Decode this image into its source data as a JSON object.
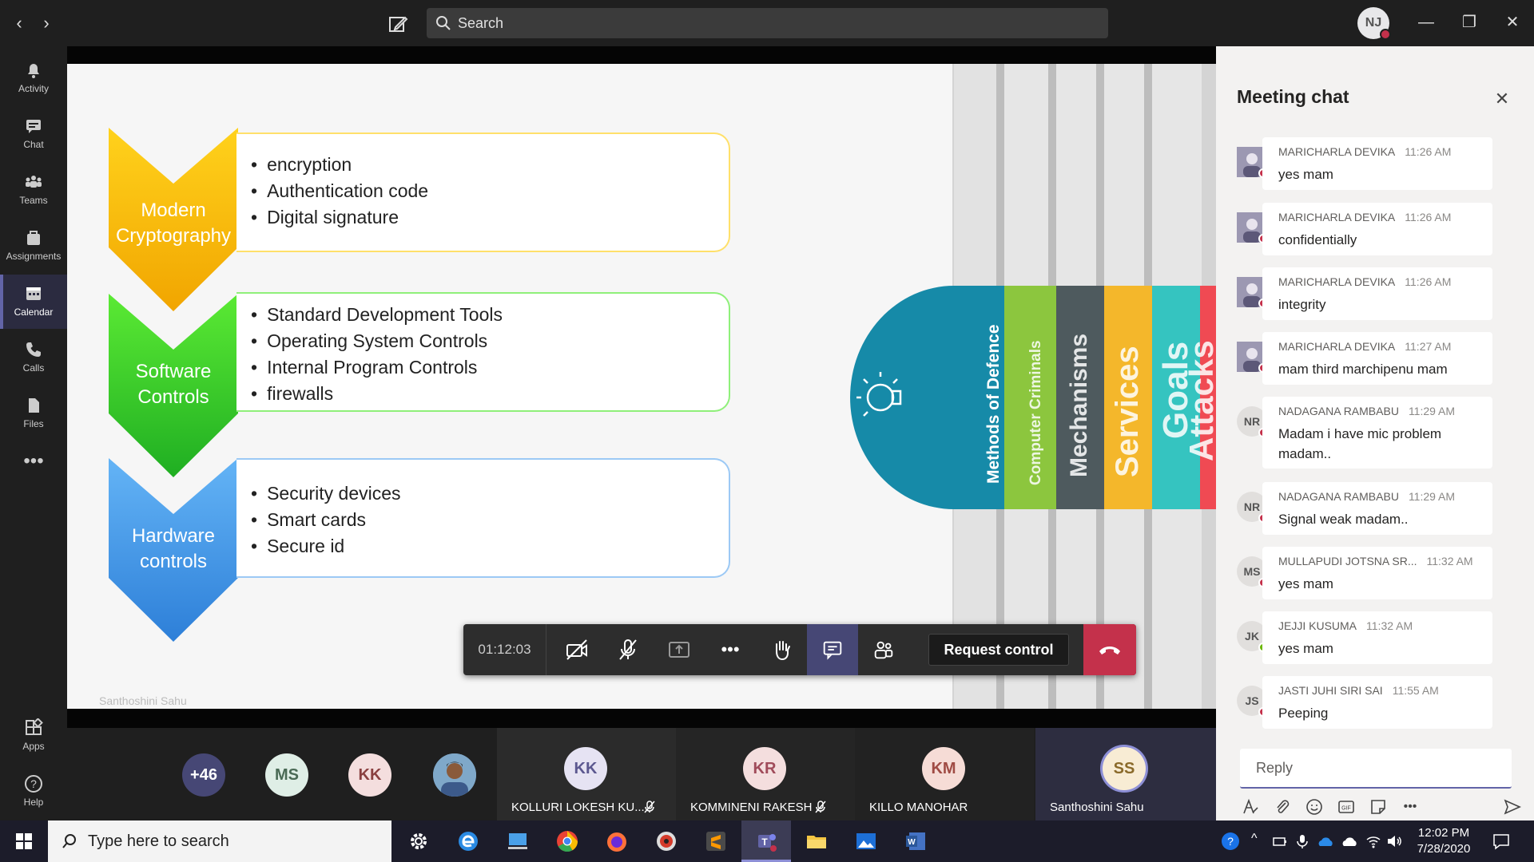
{
  "topbar": {
    "search_placeholder": "Search",
    "user_initials": "NJ"
  },
  "rail": {
    "items": [
      {
        "label": "Activity",
        "icon": "bell-icon"
      },
      {
        "label": "Chat",
        "icon": "chat-icon"
      },
      {
        "label": "Teams",
        "icon": "teams-icon"
      },
      {
        "label": "Assignments",
        "icon": "assignments-icon"
      },
      {
        "label": "Calendar",
        "icon": "calendar-icon",
        "active": true
      },
      {
        "label": "Calls",
        "icon": "phone-icon"
      },
      {
        "label": "Files",
        "icon": "files-icon"
      },
      {
        "label": "Apps",
        "icon": "apps-icon"
      },
      {
        "label": "Help",
        "icon": "help-icon"
      }
    ]
  },
  "slide": {
    "sections": [
      {
        "title_line1": "Modern",
        "title_line2": "Cryptography",
        "items": [
          "encryption",
          "Authentication code",
          "Digital signature"
        ],
        "color": "#f5b400"
      },
      {
        "title_line1": "Software",
        "title_line2": "Controls",
        "items": [
          "Standard Development Tools",
          "Operating System Controls",
          "Internal Program Controls",
          "firewalls"
        ],
        "color": "#2ec52e"
      },
      {
        "title_line1": "Hardware",
        "title_line2": "controls",
        "items": [
          "Security devices",
          "Smart cards",
          "Secure id"
        ],
        "color": "#3d8fe0"
      }
    ],
    "tabs": [
      {
        "label": "Methods of Defence",
        "color": "#168aa8"
      },
      {
        "label": "Computer Criminals",
        "color": "#8cc63e"
      },
      {
        "label": "Mechanisms",
        "color": "#4e5a5e"
      },
      {
        "label": "Services",
        "color": "#f4b72b"
      },
      {
        "label": "Goals",
        "color": "#35c4c0"
      },
      {
        "label": "Attacks",
        "color": "#f04a53"
      }
    ],
    "presenter": "Santhoshini Sahu"
  },
  "controls": {
    "timer": "01:12:03",
    "request_control": "Request control"
  },
  "roster": {
    "overflow": "+46",
    "small_avatars": [
      {
        "initials": "MS",
        "bg": "#dfeee6",
        "fg": "#4a6a55"
      },
      {
        "initials": "KK",
        "bg": "#f4dede",
        "fg": "#8a4040"
      }
    ],
    "tiles": [
      {
        "initials": "KK",
        "name": "KOLLURI LOKESH KU...",
        "muted": true,
        "bg": "#e6e3f3",
        "fg": "#5c5890"
      },
      {
        "initials": "KR",
        "name": "KOMMINENI RAKESH",
        "muted": true,
        "bg": "#f4dede",
        "fg": "#a04b5a"
      },
      {
        "initials": "KM",
        "name": "KILLO MANOHAR",
        "muted": false,
        "bg": "#f6dcd6",
        "fg": "#a04b44"
      },
      {
        "initials": "SS",
        "name": "Santhoshini Sahu",
        "muted": false,
        "bg": "#f8ecd4",
        "fg": "#8a6a2a"
      }
    ]
  },
  "chat": {
    "title": "Meeting chat",
    "reply_placeholder": "Reply",
    "messages": [
      {
        "avatar": "img",
        "initials": "",
        "status": "busy",
        "sender": "MARICHARLA DEVIKA",
        "time": "11:26 AM",
        "text": "yes mam"
      },
      {
        "avatar": "img",
        "initials": "",
        "status": "busy",
        "sender": "MARICHARLA DEVIKA",
        "time": "11:26 AM",
        "text": "confidentially"
      },
      {
        "avatar": "img",
        "initials": "",
        "status": "busy",
        "sender": "MARICHARLA DEVIKA",
        "time": "11:26 AM",
        "text": "integrity"
      },
      {
        "avatar": "img",
        "initials": "",
        "status": "busy",
        "sender": "MARICHARLA DEVIKA",
        "time": "11:27 AM",
        "text": "mam third marchipenu mam"
      },
      {
        "avatar": "initials",
        "initials": "NR",
        "status": "busy",
        "sender": "NADAGANA RAMBABU",
        "time": "11:29 AM",
        "text": "Madam i have mic problem madam.."
      },
      {
        "avatar": "initials",
        "initials": "NR",
        "status": "busy",
        "sender": "NADAGANA RAMBABU",
        "time": "11:29 AM",
        "text": "Signal weak madam.."
      },
      {
        "avatar": "initials",
        "initials": "MS",
        "status": "busy",
        "sender": "MULLAPUDI JOTSNA SR...",
        "time": "11:32 AM",
        "text": "yes mam"
      },
      {
        "avatar": "initials",
        "initials": "JK",
        "status": "available",
        "sender": "JEJJI KUSUMA",
        "time": "11:32 AM",
        "text": "yes mam"
      },
      {
        "avatar": "initials",
        "initials": "JS",
        "status": "busy",
        "sender": "JASTI JUHI SIRI SAI",
        "time": "11:55 AM",
        "text": "Peeping"
      }
    ]
  },
  "taskbar": {
    "search_placeholder": "Type here to search",
    "time": "12:02 PM",
    "date": "7/28/2020"
  },
  "colors": {
    "accent": "#6264a7",
    "hangup": "#c4314b",
    "busy": "#c4314b",
    "available": "#6bb700"
  }
}
